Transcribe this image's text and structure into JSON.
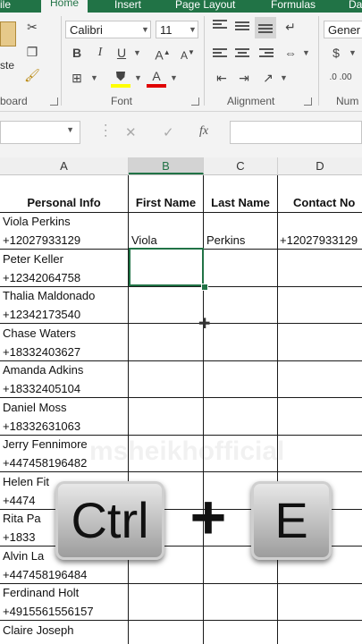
{
  "ribbon_tabs": [
    "ile",
    "Home",
    "Insert",
    "Page Layout",
    "Formulas",
    "Da"
  ],
  "active_tab": "Home",
  "clipboard": {
    "paste_label": "ste",
    "group_label": "board"
  },
  "font": {
    "name": "Calibri",
    "size": "11",
    "bold": "B",
    "italic": "I",
    "underline": "U",
    "font_color_glyph": "A",
    "group_label": "Font"
  },
  "alignment": {
    "group_label": "Alignment"
  },
  "number": {
    "format": "Gener",
    "currency_glyph": "$",
    "group_label": "Num"
  },
  "formula_bar": {
    "cancel_glyph": "✕",
    "enter_glyph": "✓",
    "function_glyph": "fx",
    "content": ""
  },
  "columns": [
    "A",
    "B",
    "C",
    "D"
  ],
  "selected_column": "B",
  "headers": [
    "Personal Info",
    "First Name",
    "Last Name",
    "Contact No"
  ],
  "rows": [
    {
      "name": "Viola Perkins",
      "phone": "+12027933129",
      "first": "Viola",
      "last": "Perkins",
      "contact": "+12027933129"
    },
    {
      "name": "Peter Keller",
      "phone": "+12342064758",
      "first": "",
      "last": "",
      "contact": ""
    },
    {
      "name": "Thalia Maldonado",
      "phone": "+12342173540",
      "first": "",
      "last": "",
      "contact": ""
    },
    {
      "name": "Chase Waters",
      "phone": "+18332403627",
      "first": "",
      "last": "",
      "contact": ""
    },
    {
      "name": "Amanda Adkins",
      "phone": "+18332405104",
      "first": "",
      "last": "",
      "contact": ""
    },
    {
      "name": "Daniel Moss",
      "phone": "+18332631063",
      "first": "",
      "last": "",
      "contact": ""
    },
    {
      "name": "Jerry Fennimore",
      "phone": "+447458196482",
      "first": "",
      "last": "",
      "contact": ""
    },
    {
      "name": "Helen Fit",
      "phone": "+4474",
      "first": "",
      "last": "",
      "contact": ""
    },
    {
      "name": "Rita Pa",
      "phone": "+1833",
      "first": "",
      "last": "",
      "contact": ""
    },
    {
      "name": "Alvin La",
      "phone": "+447458196484",
      "first": "",
      "last": "",
      "contact": ""
    },
    {
      "name": "Ferdinand Holt",
      "phone": "+4915561556157",
      "first": "",
      "last": "",
      "contact": ""
    },
    {
      "name": "Claire Joseph",
      "phone": "",
      "first": "",
      "last": "",
      "contact": ""
    }
  ],
  "overlay": {
    "key_ctrl": "Ctrl",
    "plus": "+",
    "key_e": "E"
  },
  "watermark": "msheikhofficial",
  "colors": {
    "excel_green": "#217346",
    "ribbon_bg": "#f3f3f3"
  }
}
